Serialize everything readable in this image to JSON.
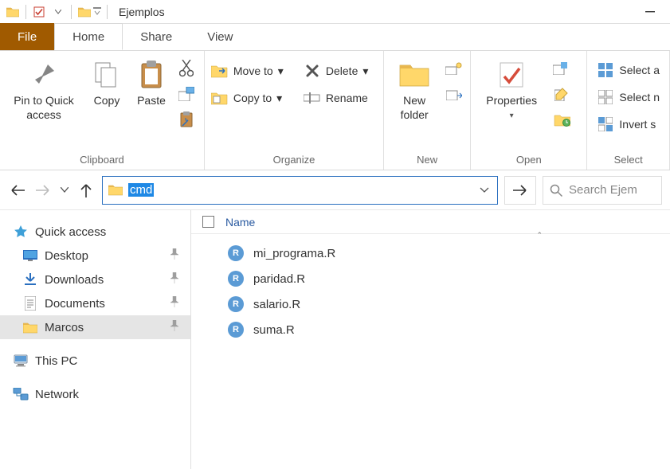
{
  "window": {
    "title": "Ejemplos"
  },
  "tabs": {
    "file": "File",
    "home": "Home",
    "share": "Share",
    "view": "View"
  },
  "ribbon": {
    "clipboard": {
      "label": "Clipboard",
      "pin": "Pin to Quick\naccess",
      "copy": "Copy",
      "paste": "Paste"
    },
    "organize": {
      "label": "Organize",
      "moveto": "Move to",
      "copyto": "Copy to",
      "delete": "Delete",
      "rename": "Rename"
    },
    "new": {
      "label": "New",
      "newfolder": "New\nfolder"
    },
    "open": {
      "label": "Open",
      "properties": "Properties"
    },
    "select": {
      "label": "Select",
      "all": "Select a",
      "none": "Select n",
      "invert": "Invert s"
    }
  },
  "address": {
    "text": "cmd"
  },
  "search": {
    "placeholder": "Search Ejem"
  },
  "sidebar": {
    "quick": "Quick access",
    "desktop": "Desktop",
    "downloads": "Downloads",
    "documents": "Documents",
    "marcos": "Marcos",
    "thispc": "This PC",
    "network": "Network"
  },
  "columns": {
    "name": "Name"
  },
  "files": [
    {
      "name": "mi_programa.R"
    },
    {
      "name": "paridad.R"
    },
    {
      "name": "salario.R"
    },
    {
      "name": "suma.R"
    }
  ]
}
